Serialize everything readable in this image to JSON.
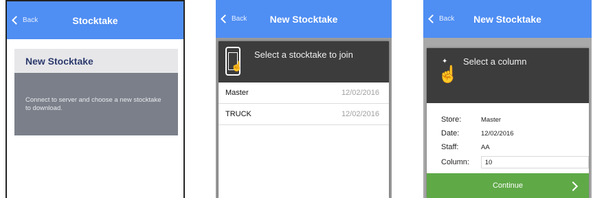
{
  "screens": [
    {
      "back_label": "Back",
      "title": "Stocktake",
      "card_title": "New Stocktake",
      "card_text": "Connect to server and choose a new stocktake to download."
    },
    {
      "back_label": "Back",
      "title": "New Stocktake",
      "panel_title": "Select a stocktake to join",
      "rows": [
        {
          "name": "Master",
          "date": "12/02/2016"
        },
        {
          "name": "TRUCK",
          "date": "12/02/2016"
        }
      ]
    },
    {
      "back_label": "Back",
      "title": "New Stocktake",
      "panel_title": "Select a column",
      "fields": {
        "store_label": "Store:",
        "store_value": "Master",
        "date_label": "Date:",
        "date_value": "12/02/2016",
        "staff_label": "Staff:",
        "staff_value": "AA",
        "column_label": "Column:",
        "column_value": "10"
      },
      "continue_label": "Continue"
    }
  ],
  "icons": [
    "chevron-left-icon",
    "phone-touch-icon",
    "tap-hand-icon",
    "chevron-right-icon"
  ],
  "colors": {
    "navbar": "#4f8ef3",
    "dark_panel": "#3c3c3c",
    "continue": "#5fa947",
    "card_title": "#2c3a6c"
  }
}
